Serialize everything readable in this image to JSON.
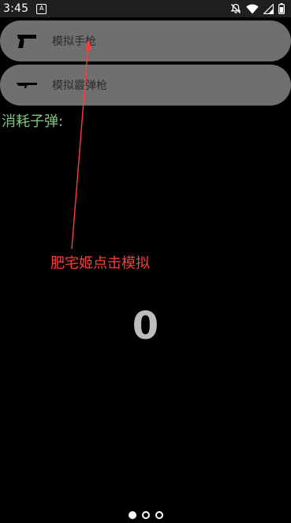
{
  "status_bar": {
    "time": "3:45",
    "notification_icon": "A",
    "icons": [
      "silent-alarm-icon",
      "wifi-icon",
      "cellular-signal-icon",
      "battery-icon"
    ]
  },
  "buttons": [
    {
      "label": "模拟手枪",
      "icon": "pistol-icon"
    },
    {
      "label": "模拟霰弹枪",
      "icon": "shotgun-icon"
    }
  ],
  "ammo": {
    "label": "消耗子弹:",
    "count": "0"
  },
  "annotation": {
    "text": "肥宅姬点击模拟",
    "color": "#ff3b3b"
  },
  "pager": {
    "pages": 3,
    "active_index": 0
  },
  "colors": {
    "background": "#000000",
    "button_bg": "#6f6f6f",
    "ammo_label": "#7fc67f",
    "counter": "#bdbdbd"
  }
}
